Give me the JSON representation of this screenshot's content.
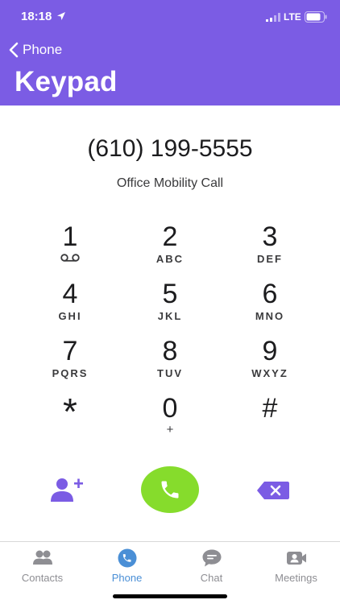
{
  "status_bar": {
    "time": "18:18",
    "network": "LTE"
  },
  "nav": {
    "back_label": "Phone",
    "title": "Keypad"
  },
  "dialer": {
    "number": "(610) 199-5555",
    "call_type": "Office Mobility Call"
  },
  "keys": [
    {
      "digit": "1",
      "letters": ""
    },
    {
      "digit": "2",
      "letters": "ABC"
    },
    {
      "digit": "3",
      "letters": "DEF"
    },
    {
      "digit": "4",
      "letters": "GHI"
    },
    {
      "digit": "5",
      "letters": "JKL"
    },
    {
      "digit": "6",
      "letters": "MNO"
    },
    {
      "digit": "7",
      "letters": "PQRS"
    },
    {
      "digit": "8",
      "letters": "TUV"
    },
    {
      "digit": "9",
      "letters": "WXYZ"
    },
    {
      "digit": "*",
      "letters": ""
    },
    {
      "digit": "0",
      "letters": "+"
    },
    {
      "digit": "#",
      "letters": ""
    }
  ],
  "tabs": [
    {
      "label": "Contacts",
      "icon": "contacts-icon"
    },
    {
      "label": "Phone",
      "icon": "phone-icon"
    },
    {
      "label": "Chat",
      "icon": "chat-icon"
    },
    {
      "label": "Meetings",
      "icon": "video-camera-icon"
    }
  ],
  "active_tab": "Phone",
  "colors": {
    "header": "#7b5ce4",
    "call_button": "#86dc2c",
    "accent_icon": "#7b5ce4",
    "active_tab": "#4a8fd6",
    "inactive_tab": "#8e8e93"
  }
}
